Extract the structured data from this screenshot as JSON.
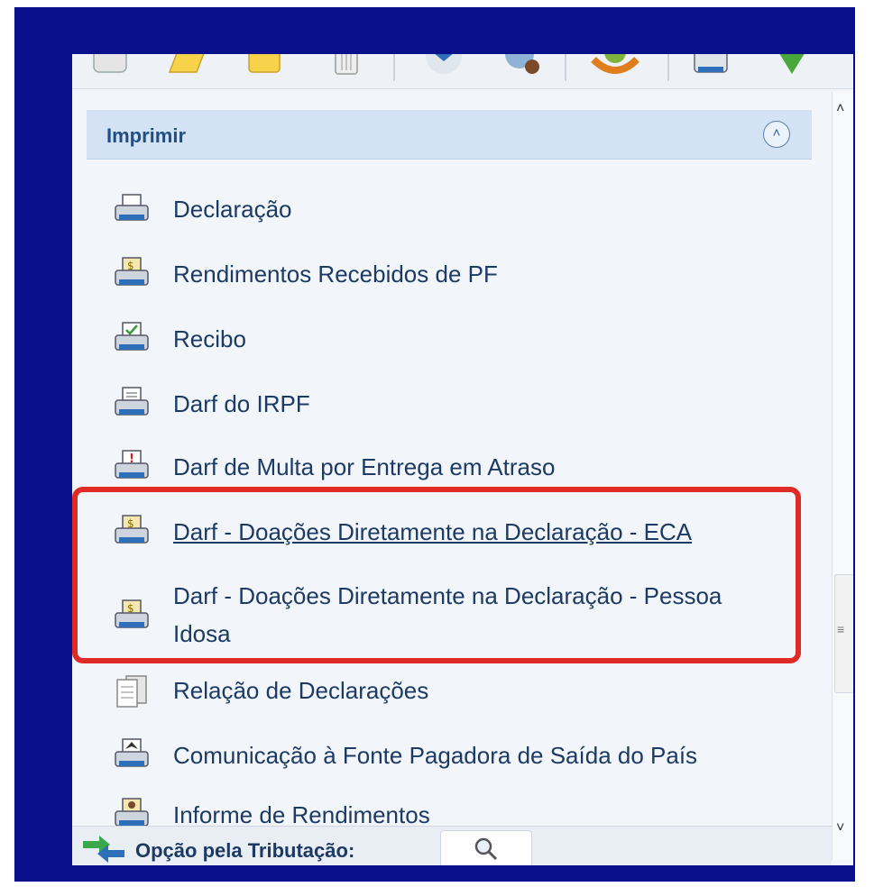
{
  "panel": {
    "title": "Imprimir",
    "collapse_icon": "double-chevron-up-icon"
  },
  "items": [
    {
      "label": "Declaração",
      "icon": "printer-icon"
    },
    {
      "label": "Rendimentos Recebidos de PF",
      "icon": "printer-dollar-icon"
    },
    {
      "label": "Recibo",
      "icon": "printer-check-icon"
    },
    {
      "label": "Darf do IRPF",
      "icon": "printer-document-icon"
    },
    {
      "label": "Darf de Multa por Entrega em Atraso",
      "icon": "printer-alert-icon"
    },
    {
      "label": "Darf - Doações Diretamente na Declaração - ECA",
      "icon": "printer-dollar-icon"
    },
    {
      "label": "Darf - Doações Diretamente na Declaração - Pessoa Idosa",
      "icon": "printer-dollar-icon"
    },
    {
      "label": "Relação de Declarações",
      "icon": "document-stack-icon"
    },
    {
      "label": "Comunicação à Fonte Pagadora de Saída do País",
      "icon": "printer-airplane-icon"
    },
    {
      "label": "Informe de Rendimentos",
      "icon": "printer-person-icon"
    }
  ],
  "bottom": {
    "label": "Opção pela Tributação:",
    "icon": "arrows-icon",
    "search_icon": "search-icon"
  },
  "colors": {
    "frame": "#0a0f8c",
    "highlight": "#e02a25",
    "panel_header": "#d3e3f5",
    "text": "#1c3a63"
  }
}
